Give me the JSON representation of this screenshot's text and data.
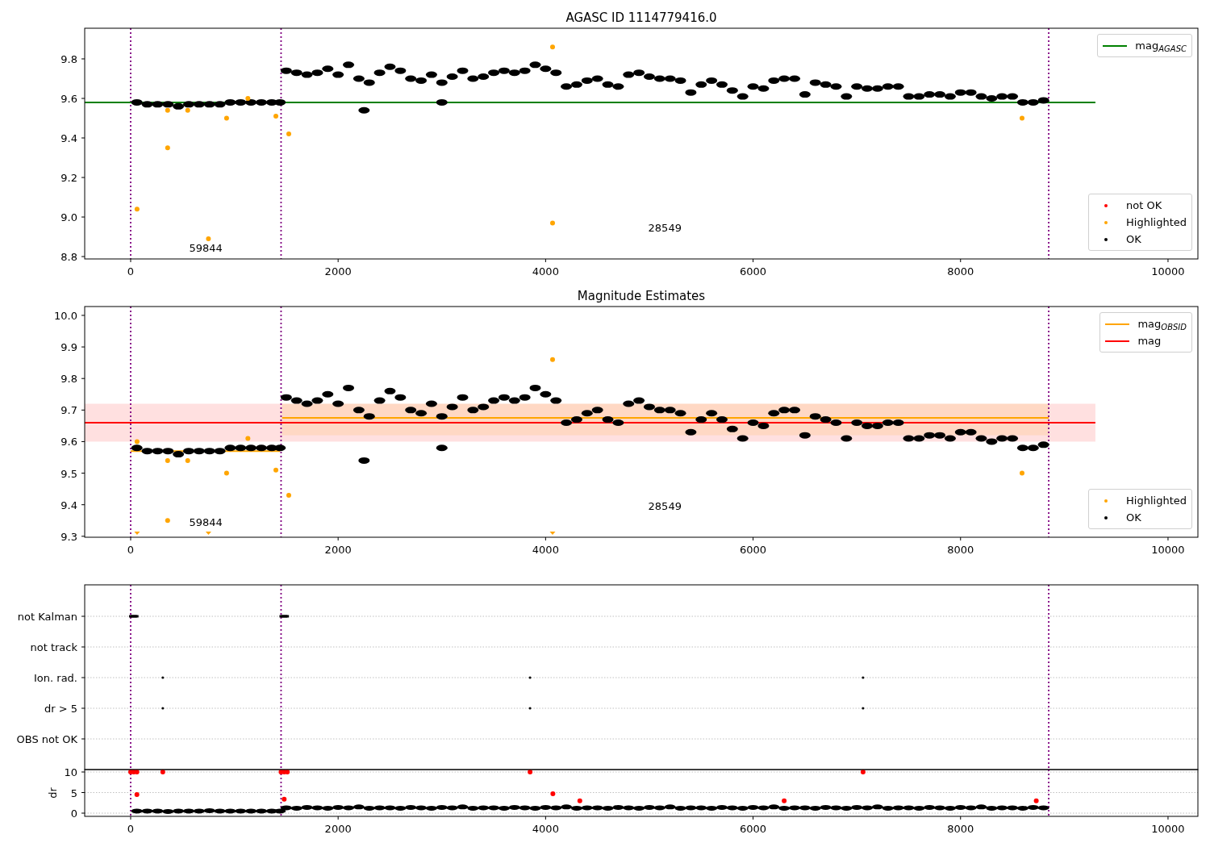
{
  "figure_title": "AGASC ID 1114779416.0",
  "panels": [
    {
      "chart_data": {
        "type": "scatter",
        "xlim": [
          -443,
          10288
        ],
        "ylim": [
          8.788,
          9.955
        ],
        "xticks": [
          0,
          2000,
          4000,
          6000,
          8000,
          10000
        ],
        "yticks": [
          8.8,
          {
            "value": 9,
            "label": "9.0"
          },
          9.2,
          9.4,
          9.6,
          9.8
        ],
        "series": [
          {
            "name": "mag$_{AGASC}$",
            "type": "line",
            "color": "#008000",
            "x": [
              -443,
              9300
            ],
            "values": [
              9.58,
              9.58
            ]
          },
          {
            "name": "not OK",
            "type": "scatter",
            "color": "#ff0000"
          },
          {
            "name": "Highlighted",
            "type": "scatter",
            "color": "#ffa500",
            "x": [
              62,
              356,
              356,
              550,
              750,
              925,
              1130,
              1400,
              1524,
              4067,
              4067,
              8593
            ],
            "values": [
              9.04,
              9.35,
              9.54,
              9.54,
              8.89,
              9.5,
              9.6,
              9.51,
              9.42,
              9.86,
              8.97,
              9.5
            ]
          },
          {
            "name": "OK",
            "type": "scatter",
            "color": "#000000",
            "x": [
              60,
              160,
              260,
              360,
              460,
              560,
              660,
              760,
              860,
              960,
              1060,
              1160,
              1260,
              1360,
              1440,
              1500,
              1600,
              1700,
              1800,
              1900,
              2000,
              2100,
              2200,
              2300,
              2400,
              2500,
              2600,
              2700,
              2800,
              2900,
              3000,
              3100,
              3200,
              3300,
              3400,
              3500,
              3600,
              3700,
              3800,
              3900,
              4000,
              4100,
              4200,
              4300,
              4400,
              4500,
              4600,
              4700,
              4800,
              4900,
              5000,
              5100,
              5200,
              5300,
              5400,
              5500,
              5600,
              5700,
              5800,
              5900,
              6000,
              6100,
              6200,
              6300,
              6400,
              6500,
              6600,
              6700,
              6800,
              6900,
              7000,
              7100,
              7200,
              7300,
              7400,
              7500,
              7600,
              7700,
              7800,
              7900,
              8000,
              8100,
              8200,
              8300,
              8400,
              8500,
              8600,
              8700,
              8800,
              2250,
              3000
            ],
            "values": [
              9.58,
              9.57,
              9.57,
              9.57,
              9.56,
              9.57,
              9.57,
              9.57,
              9.57,
              9.58,
              9.58,
              9.58,
              9.58,
              9.58,
              9.58,
              9.74,
              9.73,
              9.72,
              9.73,
              9.75,
              9.72,
              9.77,
              9.7,
              9.68,
              9.73,
              9.76,
              9.74,
              9.7,
              9.69,
              9.72,
              9.68,
              9.71,
              9.74,
              9.7,
              9.71,
              9.73,
              9.74,
              9.73,
              9.74,
              9.77,
              9.75,
              9.73,
              9.66,
              9.67,
              9.69,
              9.7,
              9.67,
              9.66,
              9.72,
              9.73,
              9.71,
              9.7,
              9.7,
              9.69,
              9.63,
              9.67,
              9.69,
              9.67,
              9.64,
              9.61,
              9.66,
              9.65,
              9.69,
              9.7,
              9.7,
              9.62,
              9.68,
              9.67,
              9.66,
              9.61,
              9.66,
              9.65,
              9.65,
              9.66,
              9.66,
              9.61,
              9.61,
              9.62,
              9.62,
              9.61,
              9.63,
              9.63,
              9.61,
              9.6,
              9.61,
              9.61,
              9.58,
              9.58,
              9.59,
              9.54,
              9.58
            ]
          }
        ],
        "ref_lines": [
          {
            "axis": "x",
            "value": 0,
            "color": "#800080"
          },
          {
            "axis": "x",
            "value": 1450,
            "color": "#800080"
          },
          {
            "axis": "x",
            "value": 8850,
            "color": "#800080"
          }
        ],
        "annotations": [
          "59844",
          "28549"
        ]
      }
    },
    {
      "chart_data": {
        "type": "scatter",
        "title": "Magnitude Estimates",
        "xlim": [
          -443,
          10288
        ],
        "ylim": [
          9.297,
          10.028
        ],
        "xticks": [
          0,
          2000,
          4000,
          6000,
          8000,
          10000
        ],
        "yticks": [
          9.3,
          9.4,
          9.5,
          9.6,
          9.7,
          9.8,
          9.9,
          {
            "value": 10,
            "label": "10.0"
          }
        ],
        "series": [
          {
            "name": "mag$_{OBSID}$",
            "type": "line",
            "color": "#ffa500",
            "x": [
              0,
              1440,
              null,
              1460,
              8850
            ],
            "values": [
              9.57,
              9.57,
              null,
              9.675,
              9.675
            ]
          },
          {
            "name": "mag",
            "type": "line",
            "color": "#ff0000",
            "x": [
              -443,
              9300
            ],
            "values": [
              9.66,
              9.66
            ]
          },
          {
            "name": "Highlighted",
            "type": "scatter",
            "color": "#ffa500",
            "x": [
              62,
              62,
              356,
              356,
              550,
              750,
              925,
              1130,
              1400,
              1524,
              4067,
              4067,
              8593
            ],
            "values": [
              9.6,
              9.31,
              9.35,
              9.54,
              9.54,
              9.31,
              9.5,
              9.61,
              9.51,
              9.43,
              9.86,
              9.31,
              9.5
            ]
          },
          {
            "name": "OK",
            "type": "scatter",
            "color": "#000000",
            "x": [
              60,
              160,
              260,
              360,
              460,
              560,
              660,
              760,
              860,
              960,
              1060,
              1160,
              1260,
              1360,
              1440,
              1500,
              1600,
              1700,
              1800,
              1900,
              2000,
              2100,
              2200,
              2300,
              2400,
              2500,
              2600,
              2700,
              2800,
              2900,
              3000,
              3100,
              3200,
              3300,
              3400,
              3500,
              3600,
              3700,
              3800,
              3900,
              4000,
              4100,
              4200,
              4300,
              4400,
              4500,
              4600,
              4700,
              4800,
              4900,
              5000,
              5100,
              5200,
              5300,
              5400,
              5500,
              5600,
              5700,
              5800,
              5900,
              6000,
              6100,
              6200,
              6300,
              6400,
              6500,
              6600,
              6700,
              6800,
              6900,
              7000,
              7100,
              7200,
              7300,
              7400,
              7500,
              7600,
              7700,
              7800,
              7900,
              8000,
              8100,
              8200,
              8300,
              8400,
              8500,
              8600,
              8700,
              8800,
              2250,
              3000
            ],
            "values": [
              9.58,
              9.57,
              9.57,
              9.57,
              9.56,
              9.57,
              9.57,
              9.57,
              9.57,
              9.58,
              9.58,
              9.58,
              9.58,
              9.58,
              9.58,
              9.74,
              9.73,
              9.72,
              9.73,
              9.75,
              9.72,
              9.77,
              9.7,
              9.68,
              9.73,
              9.76,
              9.74,
              9.7,
              9.69,
              9.72,
              9.68,
              9.71,
              9.74,
              9.7,
              9.71,
              9.73,
              9.74,
              9.73,
              9.74,
              9.77,
              9.75,
              9.73,
              9.66,
              9.67,
              9.69,
              9.7,
              9.67,
              9.66,
              9.72,
              9.73,
              9.71,
              9.7,
              9.7,
              9.69,
              9.63,
              9.67,
              9.69,
              9.67,
              9.64,
              9.61,
              9.66,
              9.65,
              9.69,
              9.7,
              9.7,
              9.62,
              9.68,
              9.67,
              9.66,
              9.61,
              9.66,
              9.65,
              9.65,
              9.66,
              9.66,
              9.61,
              9.61,
              9.62,
              9.62,
              9.61,
              9.63,
              9.63,
              9.61,
              9.6,
              9.61,
              9.61,
              9.58,
              9.58,
              9.59,
              9.54,
              9.58
            ]
          }
        ],
        "bands": [
          {
            "axis": "y",
            "from": 9.6,
            "to": 9.72,
            "color": "#ff0000"
          },
          {
            "axis": "y",
            "from": 9.62,
            "to": 9.72,
            "color": "#ffa500"
          }
        ],
        "ref_lines": [
          {
            "axis": "x",
            "value": 0,
            "color": "#800080"
          },
          {
            "axis": "x",
            "value": 1450,
            "color": "#800080"
          },
          {
            "axis": "x",
            "value": 8850,
            "color": "#800080"
          }
        ],
        "annotations": [
          "59844",
          "28549"
        ]
      }
    },
    {
      "flag_labels": [
        "not Kalman",
        "not track",
        "Ion. rad.",
        "dr > 5",
        "OBS not OK"
      ]
    },
    {
      "chart_data": {
        "type": "scatter",
        "ylabel": "dr",
        "grid": true,
        "xlim": [
          -443,
          10288
        ],
        "ylim": [
          -0.78,
          10.59
        ],
        "xticks": [
          0,
          2000,
          4000,
          6000,
          8000,
          10000
        ],
        "yticks": [
          0,
          5,
          10
        ],
        "series": [
          {
            "type": "scatter",
            "color": "#ff0000",
            "x": [
              0,
              30,
              60,
              1450,
              1480,
              1510,
              310,
              3850,
              7060,
              60,
              1480,
              4070,
              4330,
              6300,
              8730
            ],
            "values": [
              10,
              10,
              10,
              10,
              10,
              10,
              10,
              10,
              10,
              4.5,
              3.4,
              4.7,
              3,
              3,
              3
            ]
          },
          {
            "type": "scatter",
            "color": "#000000",
            "x": [
              60,
              160,
              260,
              360,
              460,
              560,
              660,
              760,
              860,
              960,
              1060,
              1160,
              1260,
              1360,
              1440,
              1500,
              1600,
              1700,
              1800,
              1900,
              2000,
              2100,
              2200,
              2300,
              2400,
              2500,
              2600,
              2700,
              2800,
              2900,
              3000,
              3100,
              3200,
              3300,
              3400,
              3500,
              3600,
              3700,
              3800,
              3900,
              4000,
              4100,
              4200,
              4300,
              4400,
              4500,
              4600,
              4700,
              4800,
              4900,
              5000,
              5100,
              5200,
              5300,
              5400,
              5500,
              5600,
              5700,
              5800,
              5900,
              6000,
              6100,
              6200,
              6300,
              6400,
              6500,
              6600,
              6700,
              6800,
              6900,
              7000,
              7100,
              7200,
              7300,
              7400,
              7500,
              7600,
              7700,
              7800,
              7900,
              8000,
              8100,
              8200,
              8300,
              8400,
              8500,
              8600,
              8700,
              8800
            ],
            "values": [
              0.5,
              0.5,
              0.5,
              0.4,
              0.5,
              0.5,
              0.5,
              0.6,
              0.5,
              0.5,
              0.5,
              0.5,
              0.5,
              0.5,
              0.5,
              1.3,
              1.2,
              1.4,
              1.3,
              1.2,
              1.4,
              1.3,
              1.5,
              1.2,
              1.3,
              1.3,
              1.2,
              1.4,
              1.3,
              1.2,
              1.4,
              1.3,
              1.5,
              1.2,
              1.3,
              1.3,
              1.2,
              1.4,
              1.3,
              1.2,
              1.4,
              1.3,
              1.5,
              1.2,
              1.3,
              1.3,
              1.2,
              1.4,
              1.3,
              1.2,
              1.4,
              1.3,
              1.5,
              1.2,
              1.3,
              1.3,
              1.2,
              1.4,
              1.3,
              1.2,
              1.4,
              1.3,
              1.5,
              1.2,
              1.3,
              1.3,
              1.2,
              1.4,
              1.3,
              1.2,
              1.4,
              1.3,
              1.5,
              1.2,
              1.3,
              1.3,
              1.2,
              1.4,
              1.3,
              1.2,
              1.4,
              1.3,
              1.5,
              1.2,
              1.3,
              1.3,
              1.2,
              1.4,
              1.3
            ]
          }
        ],
        "ref_lines": [
          {
            "axis": "x",
            "value": 0,
            "color": "#800080"
          },
          {
            "axis": "x",
            "value": 1450,
            "color": "#800080"
          },
          {
            "axis": "x",
            "value": 8850,
            "color": "#800080"
          }
        ]
      }
    }
  ]
}
